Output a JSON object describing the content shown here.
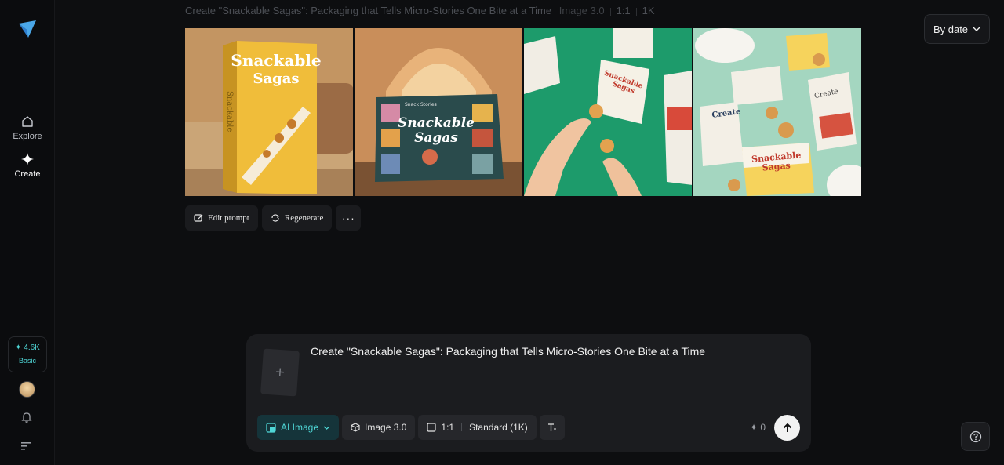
{
  "nav": {
    "explore_label": "Explore",
    "create_label": "Create"
  },
  "credits": {
    "amount": "✦ 4.6K",
    "plan": "Basic"
  },
  "header": {
    "title": "Create \"Snackable Sagas\": Packaging that Tells Micro-Stories One Bite at a Time",
    "model": "Image 3.0",
    "ratio": "1:1",
    "resolution": "1K",
    "sort_label": "By date"
  },
  "gallery": {
    "images": [
      {
        "box_title_1": "Snackable",
        "box_title_2": "Sagas",
        "spine_text": "Snackable"
      },
      {
        "box_title_1": "Snackable",
        "box_title_2": "Sagas",
        "corner_text": "Snack Stories"
      },
      {
        "pack_title_1": "Snackable",
        "pack_title_2": "Sagas"
      },
      {
        "pack_a": "Create",
        "pack_b": "Create",
        "pack_c_1": "Snackable",
        "pack_c_2": "Sagas"
      }
    ]
  },
  "actions": {
    "edit_label": "Edit prompt",
    "regenerate_label": "Regenerate",
    "more_label": "···"
  },
  "composer": {
    "prompt": "Create \"Snackable Sagas\": Packaging that Tells Micro-Stories One Bite at a Time",
    "add_label": "+",
    "mode_label": "AI Image",
    "model_label": "Image 3.0",
    "ratio_label": "1:1",
    "quality_label": "Standard (1K)",
    "cost": "✦ 0"
  },
  "colors": {
    "accent": "#4fd7d7",
    "background": "#0d0e10",
    "panel": "#1b1c1f"
  }
}
